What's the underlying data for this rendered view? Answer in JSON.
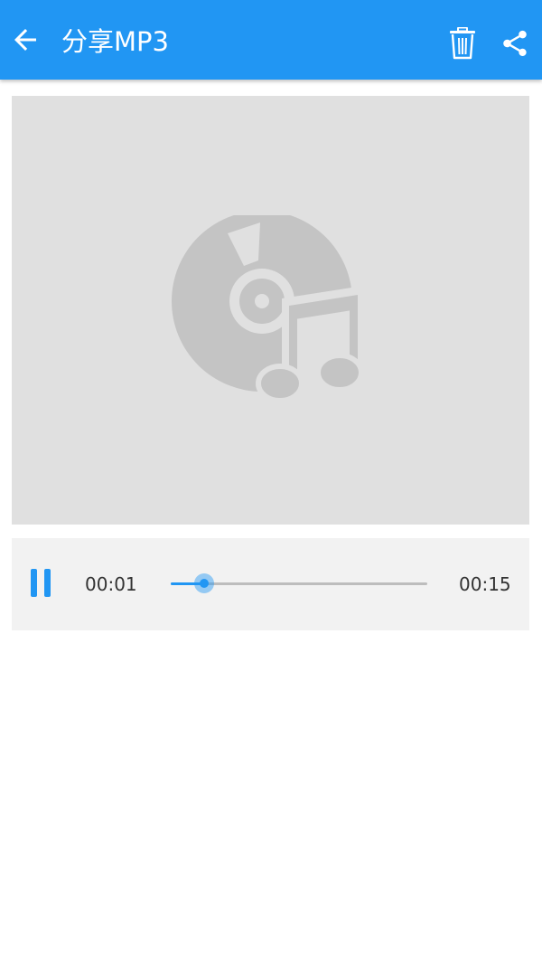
{
  "appbar": {
    "title": "分享MP3",
    "back_icon": "arrow-back-icon",
    "delete_icon": "trash-icon",
    "share_icon": "share-icon",
    "color": "#2196F3"
  },
  "artwork": {
    "icon": "music-disc-icon",
    "background": "#e0e0e0"
  },
  "player": {
    "state_icon": "pause-icon",
    "current_time": "00:01",
    "total_time": "00:15",
    "progress": 0.13
  }
}
